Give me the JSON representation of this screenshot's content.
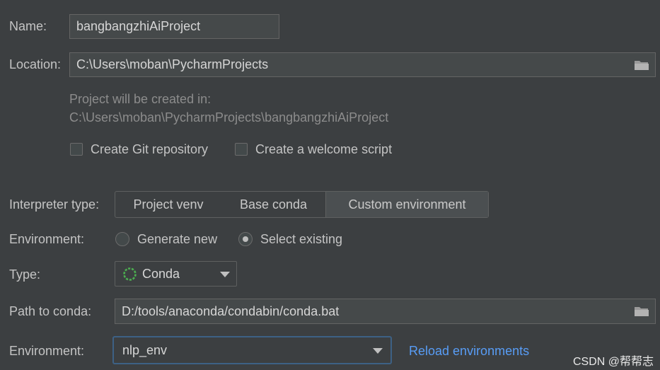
{
  "name": {
    "label": "Name:",
    "value": "bangbangzhiAiProject"
  },
  "location": {
    "label": "Location:",
    "value": "C:\\Users\\moban\\PycharmProjects",
    "browse_icon": "folder-icon"
  },
  "project_info": {
    "line1": "Project will be created in:",
    "line2": "C:\\Users\\moban\\PycharmProjects\\bangbangzhiAiProject"
  },
  "options": {
    "git": {
      "label": "Create Git repository",
      "checked": false
    },
    "welcome": {
      "label": "Create a welcome script",
      "checked": false
    }
  },
  "interpreter": {
    "label": "Interpreter type:",
    "tabs": [
      "Project venv",
      "Base conda",
      "Custom environment"
    ],
    "selected": "Custom environment"
  },
  "environment_mode": {
    "label": "Environment:",
    "generate_new": "Generate new",
    "select_existing": "Select existing",
    "selected": "Select existing"
  },
  "type": {
    "label": "Type:",
    "value": "Conda",
    "icon": "conda-icon"
  },
  "path_to_conda": {
    "label": "Path to conda:",
    "value": "D:/tools/anaconda/condabin/conda.bat",
    "browse_icon": "folder-icon"
  },
  "environment": {
    "label": "Environment:",
    "value": "nlp_env",
    "reload_link": "Reload environments"
  },
  "watermark": "CSDN @帮帮志",
  "colors": {
    "background": "#3c3f41",
    "field": "#45494a",
    "link": "#589df6",
    "focus": "#3d6185",
    "conda_green": "#4caf50"
  }
}
